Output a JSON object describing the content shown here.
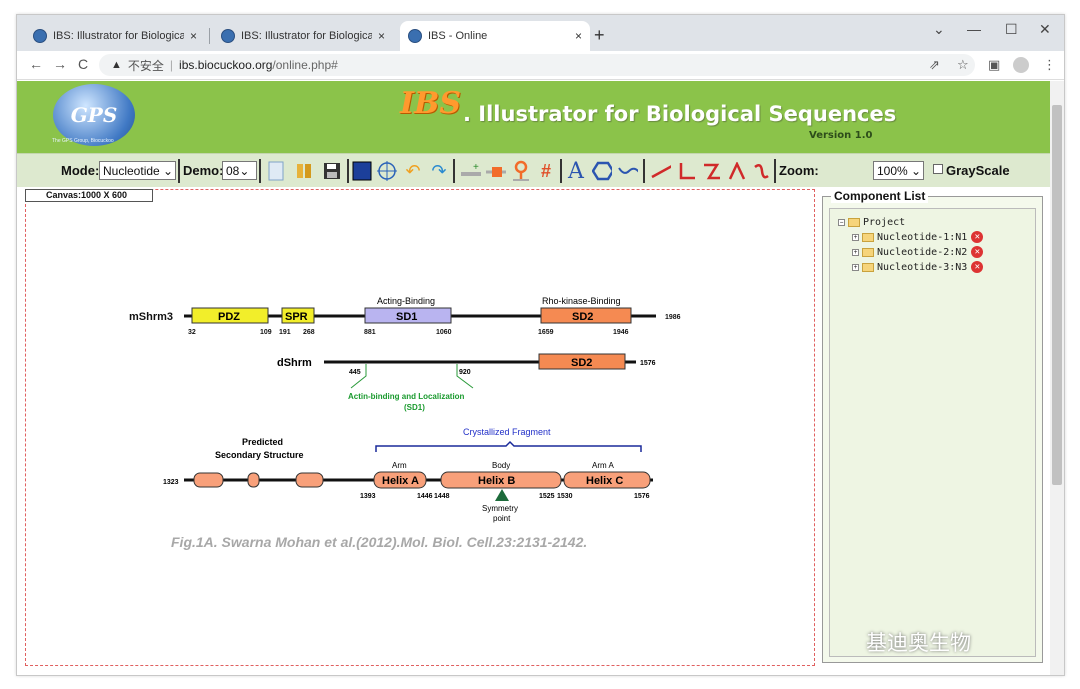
{
  "tabs": [
    {
      "title": "IBS: Illustrator for Biological Se",
      "close": "×"
    },
    {
      "title": "IBS: Illustrator for Biological Se",
      "close": "×"
    },
    {
      "title": "IBS - Online",
      "close": "×"
    }
  ],
  "new_tab": "+",
  "window_controls": {
    "chevron": "⌄",
    "minimize": "—",
    "maximize": "☐",
    "close": "✕"
  },
  "nav": {
    "back": "←",
    "forward": "→",
    "reload": "C"
  },
  "address": {
    "warning": "▲",
    "insecure": "不安全",
    "separator": "|",
    "host": "ibs.biocuckoo.org",
    "path": "/online.php#"
  },
  "header": {
    "logo": "GPS",
    "logo_caption": "The GPS Group, Biocuckoo",
    "brand": "IBS",
    "dot": ".",
    "title": "Illustrator for Biological Sequences",
    "version": "Version 1.0"
  },
  "toolbar": {
    "mode_label": "Mode:",
    "mode_value": "Nucleotide",
    "demo_label": "Demo:",
    "demo_value": "08",
    "zoom_label": "Zoom:",
    "zoom_value": "100%",
    "grayscale_label": "GrayScale",
    "dropdown_arrow": "⌄"
  },
  "canvas": {
    "label": "Canvas:1000 X 600"
  },
  "figure": {
    "protein1": "mShrm3",
    "protein2": "dShrm",
    "pdz": "PDZ",
    "spr": "SPR",
    "sd1": "SD1",
    "sd2": "SD2",
    "acting_binding": "Acting-Binding",
    "rho_binding": "Rho-kinase-Binding",
    "n32": "32",
    "n109": "109",
    "n191": "191",
    "n268": "268",
    "n881": "881",
    "n1060": "1060",
    "n1659": "1659",
    "n1946": "1946",
    "n1986": "1986",
    "n1576a": "1576",
    "n445": "445",
    "n920": "920",
    "actin_binding": "Actin-binding and Localization",
    "sd1_paren": "(SD1)",
    "predicted1": "Predicted",
    "predicted2": "Secondary Structure",
    "crystallized": "Crystallized Fragment",
    "arm": "Arm",
    "body": "Body",
    "arm_a": "Arm A",
    "helix_a": "Helix A",
    "helix_b": "Helix B",
    "helix_c": "Helix C",
    "n1323": "1323",
    "n1393": "1393",
    "n1446": "1446",
    "n1448": "1448",
    "n1525": "1525",
    "n1530": "1530",
    "n1576b": "1576",
    "symmetry1": "Symmetry",
    "symmetry2": "point",
    "citation": "Fig.1A. Swarna Mohan et al.(2012).Mol. Biol. Cell.23:2131-2142."
  },
  "component_list": {
    "title": "Component List",
    "project": "Project",
    "items": [
      {
        "label": "Nucleotide-1:N1"
      },
      {
        "label": "Nucleotide-2:N2"
      },
      {
        "label": "Nucleotide-3:N3"
      }
    ],
    "expander": "+",
    "root_expander": "−",
    "delete_glyph": "✕"
  },
  "watermark": "基迪奥生物",
  "icons": [
    "page-icon",
    "book-icon",
    "save-icon",
    "screen-icon",
    "crosshair-icon",
    "undo-icon",
    "redo-icon",
    "add-line-icon",
    "block-icon",
    "pin-icon",
    "hash-icon",
    "text-icon",
    "hexagon-icon",
    "wave-line-icon",
    "line-icon",
    "l-shape-icon",
    "z-shape-icon",
    "arch-icon",
    "curve-icon",
    "grayscale-checkbox"
  ],
  "colors": {
    "header_green": "#8bc34a",
    "toolbar": "#dde9cf",
    "pdz": "#f2ee2a",
    "sd1": "#b9b4f0",
    "sd2": "#f58a52",
    "helix": "#f8a07a",
    "arrow": "#1d6b3b"
  }
}
